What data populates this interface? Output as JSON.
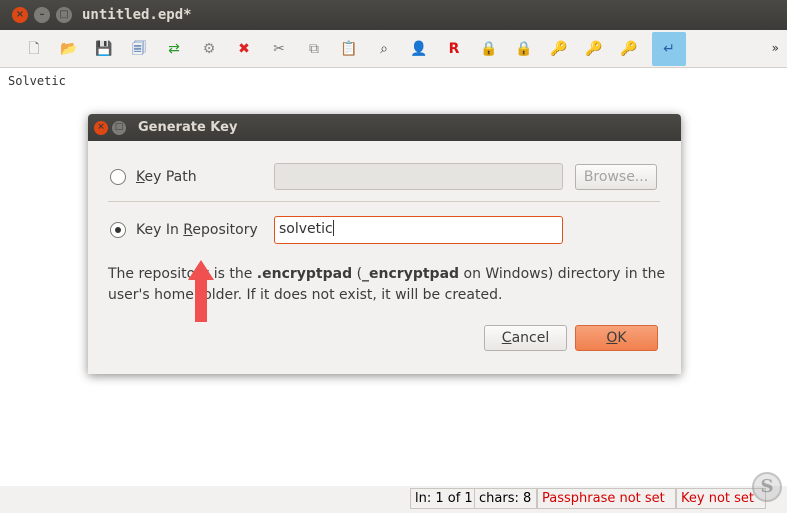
{
  "window": {
    "title": "untitled.epd*",
    "buttons": {
      "close": "×",
      "minimize": "–",
      "maximize": "□"
    }
  },
  "toolbar": {
    "icons": [
      {
        "name": "new-file-icon",
        "glyph": "🗋",
        "color": "#777777"
      },
      {
        "name": "open-folder-icon",
        "glyph": "📂",
        "color": "#e0a830"
      },
      {
        "name": "save-icon",
        "glyph": "💾",
        "color": "#2a5ea8"
      },
      {
        "name": "save-as-icon",
        "glyph": "🗐",
        "color": "#2a5ea8"
      },
      {
        "name": "encrypt-arrows-icon",
        "glyph": "⇄",
        "color": "#2a9a2a"
      },
      {
        "name": "settings-doc-icon",
        "glyph": "⚙",
        "color": "#888888"
      },
      {
        "name": "close-x-icon",
        "glyph": "✖",
        "color": "#dd2222"
      },
      {
        "name": "cut-icon",
        "glyph": "✂",
        "color": "#777777"
      },
      {
        "name": "copy-icon",
        "glyph": "⧉",
        "color": "#888888"
      },
      {
        "name": "paste-icon",
        "glyph": "📋",
        "color": "#b08a40"
      },
      {
        "name": "binoculars-icon",
        "glyph": "⌕",
        "color": "#444444"
      },
      {
        "name": "user-icon",
        "glyph": "👤",
        "color": "#c05020"
      },
      {
        "name": "replace-r-icon",
        "glyph": "R",
        "color": "#dd1111"
      },
      {
        "name": "lock-icon",
        "glyph": "🔒",
        "color": "#c8a030"
      },
      {
        "name": "lock-grey-icon",
        "glyph": "🔒",
        "color": "#8a8a8a"
      },
      {
        "name": "key-plus-icon",
        "glyph": "🔑",
        "color": "#d0a020"
      },
      {
        "name": "key-icon",
        "glyph": "🔑",
        "color": "#e0b020"
      },
      {
        "name": "key-grey-icon",
        "glyph": "🔑",
        "color": "#999999"
      },
      {
        "name": "word-wrap-icon",
        "glyph": "↵",
        "color": "#2a5ea8"
      }
    ],
    "more": "»"
  },
  "editor": {
    "content": "Solvetic"
  },
  "dialog": {
    "title": "Generate Key",
    "option_key_path": {
      "prefix": "",
      "mnemonic": "K",
      "suffix": "ey Path"
    },
    "option_key_repo": {
      "prefix": "Key In ",
      "mnemonic": "R",
      "suffix": "epository"
    },
    "browse_label": "Browse...",
    "repo_value": "solvetic",
    "info_part1": "The repository is the ",
    "info_bold1": ".encryptpad",
    "info_part2": " (",
    "info_bold2": "_encryptpad",
    "info_part3": " on Windows) directory in the user's home folder. If it does not exist, it will be created.",
    "cancel": {
      "mnemonic": "C",
      "rest": "ancel"
    },
    "ok": {
      "mnemonic": "O",
      "rest": "K"
    }
  },
  "status": {
    "position": "ln: 1 of 1",
    "chars": "chars: 8",
    "passphrase": "Passphrase not set",
    "key": "Key not set"
  },
  "colors": {
    "accent": "#e0531a",
    "arrow": "#f05050",
    "status_warning": "#d60000"
  },
  "watermark": "S"
}
